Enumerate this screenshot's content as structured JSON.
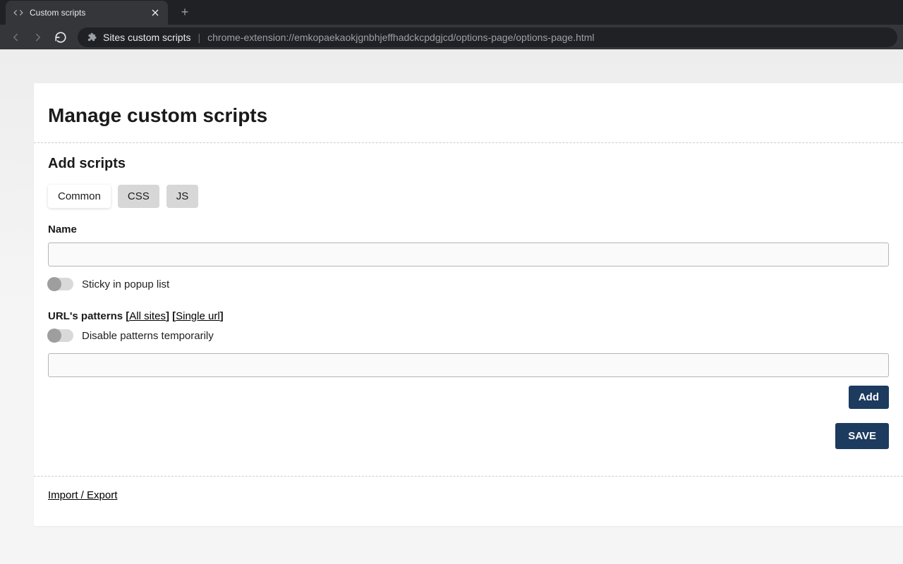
{
  "browser": {
    "tab_title": "Custom scripts",
    "extension_label": "Sites custom scripts",
    "url": "chrome-extension://emkopaekaokjgnbhjeffhadckcpdgjcd/options-page/options-page.html"
  },
  "page": {
    "title": "Manage custom scripts",
    "section_title": "Add scripts",
    "tabs": [
      {
        "label": "Common",
        "active": true
      },
      {
        "label": "CSS",
        "active": false
      },
      {
        "label": "JS",
        "active": false
      }
    ],
    "name_label": "Name",
    "name_value": "",
    "sticky_label": "Sticky in popup list",
    "patterns_label_prefix": "URL's patterns ",
    "patterns_link_all": "All sites",
    "patterns_link_single": "Single url",
    "disable_patterns_label": "Disable patterns temporarily",
    "pattern_value": "",
    "add_button": "Add",
    "save_button": "SAVE",
    "footer_link": "Import / Export"
  }
}
